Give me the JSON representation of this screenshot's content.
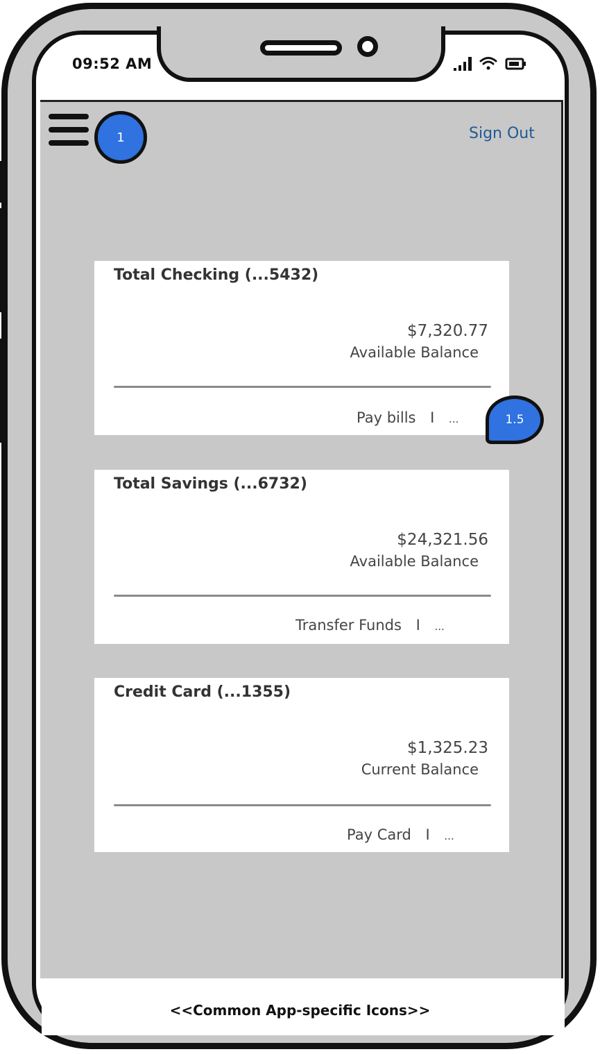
{
  "status_bar": {
    "time": "09:52 AM",
    "icons": [
      "signal-icon",
      "wifi-icon",
      "battery-icon"
    ]
  },
  "header": {
    "menu_icon": "hamburger-menu-icon",
    "badge_1": "1",
    "sign_out": "Sign Out"
  },
  "accounts": [
    {
      "name": "Total Checking  (...5432)",
      "balance": "$7,320.77",
      "balance_label": "Available Balance",
      "action": "Pay bills",
      "separator": "I",
      "more": "..."
    },
    {
      "name": "Total Savings  (...6732)",
      "balance": "$24,321.56",
      "balance_label": "Available Balance",
      "action": "Transfer Funds",
      "separator": "I",
      "more": "..."
    },
    {
      "name": "Credit Card  (...1355)",
      "balance": "$1,325.23",
      "balance_label": "Current Balance",
      "action": "Pay Card",
      "separator": "I",
      "more": "..."
    }
  ],
  "annotation_badge": "1.5",
  "footer": {
    "label": "<<Common App-specific Icons>>"
  },
  "colors": {
    "accent": "#2f72e0",
    "link": "#1f5b96",
    "background": "#c8c8c8",
    "card": "#ffffff"
  }
}
